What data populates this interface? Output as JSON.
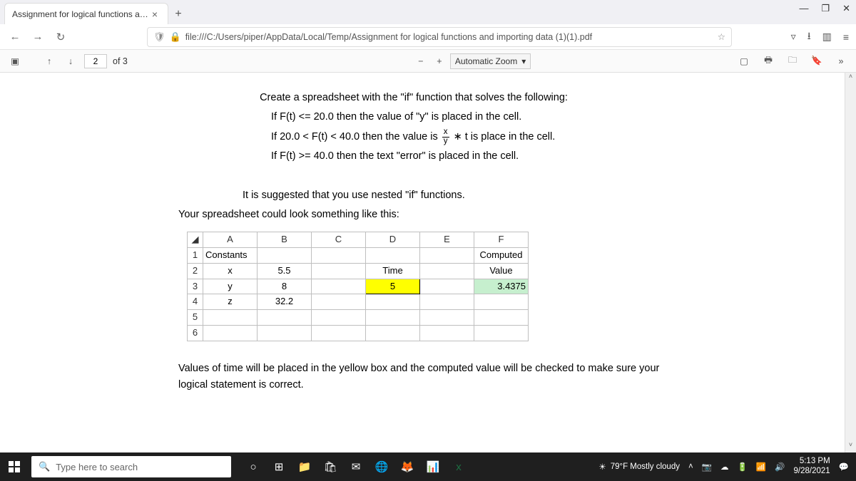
{
  "browser": {
    "tab_title": "Assignment for logical functions an…",
    "url": "file:///C:/Users/piper/AppData/Local/Temp/Assignment for logical functions and importing data (1)(1).pdf"
  },
  "pdf_toolbar": {
    "page_current": "2",
    "page_of": "of 3",
    "zoom_label": "Automatic Zoom"
  },
  "doc": {
    "line1": "Create a spreadsheet with the \"if\" function that solves the following:",
    "line2": "If F(t) <= 20.0 then the value of \"y\" is placed in the cell.",
    "line3a": "If 20.0 < F(t) < 40.0 then the value is ",
    "line3b": " ∗ t is place in the cell.",
    "frac_num": "x",
    "frac_den": "y",
    "line4": "If F(t) >= 40.0 then the text \"error\" is placed in the cell.",
    "line5": "It is suggested that you use nested \"if\" functions.",
    "line6": "Your spreadsheet could look something like this:",
    "line7": "Values of time will be placed in the yellow box and the computed value will be checked to make sure your logical statement is correct."
  },
  "sheet": {
    "cols": {
      "A": "A",
      "B": "B",
      "C": "C",
      "D": "D",
      "E": "E",
      "F": "F"
    },
    "rows": {
      "1": {
        "A": "Constants",
        "F": "Computed"
      },
      "2": {
        "A": "x",
        "B": "5.5",
        "D": "Time",
        "F": "Value"
      },
      "3": {
        "A": "y",
        "B": "8",
        "D": "5",
        "F": "3.4375"
      },
      "4": {
        "A": "z",
        "B": "32.2"
      }
    }
  },
  "taskbar": {
    "search_placeholder": "Type here to search",
    "weather": "79°F Mostly cloudy",
    "time": "5:13 PM",
    "date": "9/28/2021"
  }
}
